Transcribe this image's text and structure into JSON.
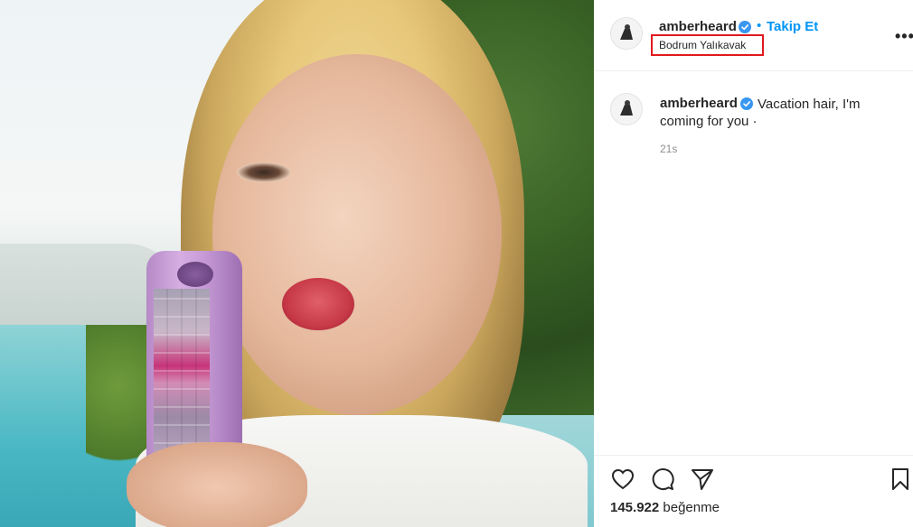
{
  "post": {
    "username": "amberheard",
    "follow_label": "Takip Et",
    "location": "Bodrum Yalıkavak",
    "more_label": "•••",
    "caption": "Vacation hair, I'm coming for you ·",
    "time": "21s",
    "likes_count": "145.922",
    "likes_word": "beğenme"
  },
  "colors": {
    "accent": "#0095f6",
    "highlight_box": "#e0191f",
    "text": "#262626",
    "muted": "#8e8e8e"
  },
  "icons": {
    "verified": "verified-badge-icon",
    "like": "heart-icon",
    "comment": "comment-icon",
    "share": "paper-plane-icon",
    "save": "bookmark-icon",
    "more": "more-options-icon"
  }
}
